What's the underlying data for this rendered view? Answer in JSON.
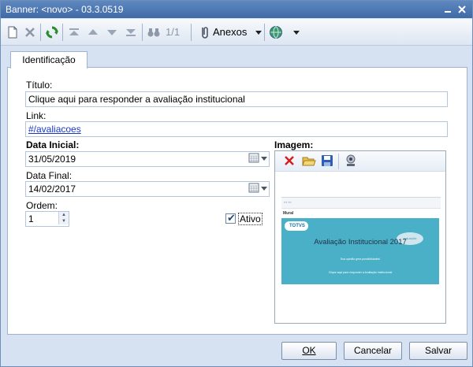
{
  "window": {
    "title": "Banner: <novo> - 03.3.0519"
  },
  "toolbar": {
    "new_icon": "new-doc-icon",
    "delete_icon": "delete-icon",
    "refresh_icon": "refresh-icon",
    "first_icon": "first-record-icon",
    "prev_icon": "previous-record-icon",
    "next_icon": "next-record-icon",
    "last_icon": "last-record-icon",
    "search_icon": "binoculars-icon",
    "page_indicator": "1/1",
    "attachments_label": "Anexos",
    "web_icon": "globe-icon"
  },
  "tabs": [
    {
      "label": "Identificação"
    }
  ],
  "form": {
    "title_label": "Título:",
    "title_value": "Clique aqui para responder a avaliação institucional",
    "link_label": "Link:",
    "link_value": "#/avaliacoes",
    "start_date_label": "Data Inicial:",
    "start_date_value": "31/05/2019",
    "end_date_label": "Data Final:",
    "end_date_value": "14/02/2017",
    "order_label": "Ordem:",
    "order_value": "1",
    "active_label": "Ativo",
    "active_checked": true,
    "image_label": "Imagem:"
  },
  "image_preview": {
    "header_text": "Mural",
    "logo_text": "TOTVS",
    "banner_title": "Avaliação Institucional 2017",
    "banner_subtitle": "Sua opinião gera possibilidades!",
    "banner_cta": "Clique aqui para responder a Avaliação Institucional",
    "cloud_text": "AVALIAÇÃO"
  },
  "buttons": {
    "ok": "OK",
    "cancel": "Cancelar",
    "save": "Salvar"
  },
  "colors": {
    "titlebar": "#4a77b2",
    "link": "#1a36c9",
    "banner_bg": "#4ab0c8"
  }
}
